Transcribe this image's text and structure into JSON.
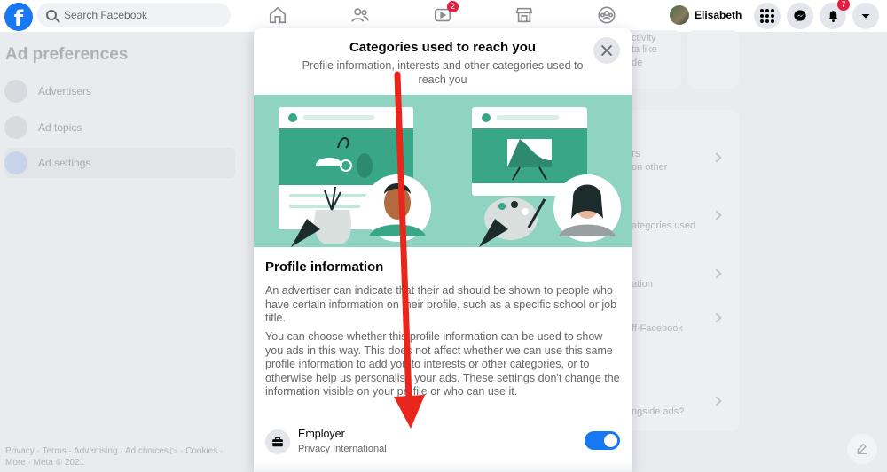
{
  "topbar": {
    "logo": "f",
    "search_placeholder": "Search Facebook",
    "watch_badge": "2",
    "profile_name": "Elisabeth",
    "notifications_badge": "7",
    "icons": [
      "home-icon",
      "friends-icon",
      "watch-icon",
      "marketplace-icon",
      "groups-icon",
      "menu-icon",
      "messenger-icon",
      "notifications-icon",
      "account-chevron-icon"
    ]
  },
  "background": {
    "title": "Ad preferences",
    "nav": [
      {
        "label": "Advertisers",
        "icon": "storefront-icon"
      },
      {
        "label": "Ad topics",
        "icon": "topics-icon"
      },
      {
        "label": "Ad settings",
        "icon": "settings-person-icon",
        "active": true
      }
    ],
    "footer": "Privacy · Terms · Advertising · Ad choices ▷ · Cookies · More · Meta © 2021",
    "right_fragments": [
      "ctivity",
      "ta like",
      "de",
      "rs",
      "on other",
      "ategories used",
      "ation",
      "ff-Facebook",
      "ngside ads?"
    ]
  },
  "modal": {
    "title": "Categories used to reach you",
    "subtitle": "Profile information, interests and other categories used to reach you",
    "section_heading": "Profile information",
    "paragraph_1": "An advertiser can indicate that their ad should be shown to people who have certain information on their profile, such as a specific school or job title.",
    "paragraph_2": "You can choose whether this profile information can be used to show you ads in this way. This does not affect whether we can use this same profile information to add you to interests or other categories, or to otherwise help us personalise your ads. These settings don't change the information visible on your profile or who can use it.",
    "setting": {
      "label": "Employer",
      "value": "Privacy International",
      "enabled": true,
      "icon": "briefcase-icon"
    }
  },
  "colors": {
    "brand_blue": "#1877f2",
    "badge_red": "#e41e3f",
    "illustration_bg": "#8fd3c1",
    "illustration_dark": "#3aa688",
    "annotation_arrow": "#e8261c"
  }
}
